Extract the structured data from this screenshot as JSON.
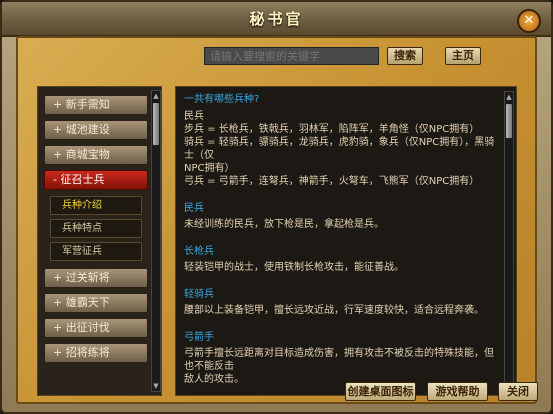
{
  "window": {
    "title": "秘书官",
    "close_label": "✕"
  },
  "search": {
    "placeholder": "请输入要搜索的关键字",
    "search_label": "搜索",
    "home_label": "主页"
  },
  "sidebar": {
    "items": [
      {
        "label": "+ 新手需知"
      },
      {
        "label": "+ 城池建设"
      },
      {
        "label": "+ 商城宝物"
      },
      {
        "label": "- 征召士兵"
      },
      {
        "label": "+ 过关斩将"
      },
      {
        "label": "+ 雄霸天下"
      },
      {
        "label": "+ 出征讨伐"
      },
      {
        "label": "+ 招将练将"
      }
    ],
    "sub_items": [
      {
        "label": "兵种介绍"
      },
      {
        "label": "兵种特点"
      },
      {
        "label": "军营征兵"
      }
    ]
  },
  "content": {
    "q_heading": "一共有哪些兵种?",
    "lines": [
      "民兵",
      "步兵 = 长枪兵，铁戟兵，羽林军，陷阵军，羊角怪（仅NPC拥有）",
      "骑兵 = 轻骑兵，骠骑兵，龙骑兵，虎豹骑，象兵（仅NPC拥有），黑骑士（仅",
      "NPC拥有）",
      "弓兵 = 弓箭手，连弩兵，神箭手，火弩车，飞熊军（仅NPC拥有）"
    ],
    "sections": [
      {
        "heading": "民兵",
        "text": "未经训练的民兵，放下枪是民，拿起枪是兵。"
      },
      {
        "heading": "长枪兵",
        "text": "轻装铠甲的战士，使用铁制长枪攻击，能征善战。"
      },
      {
        "heading": "轻骑兵",
        "text": "腰部以上装备铠甲，擅长远攻近战，行军速度较快，适合远程奔袭。"
      },
      {
        "heading": "弓箭手",
        "text": "弓箭手擅长远距离对目标造成伤害，拥有攻击不被反击的特殊技能，但也不能反击",
        "text2": "敌人的攻击。"
      }
    ]
  },
  "bottom": {
    "create_desktop_icon": "创建桌面图标",
    "game_help": "游戏帮助",
    "close": "关闭"
  },
  "colors": {
    "active_menu": "#a81c12",
    "heading_blue": "#39a8e0",
    "panel_gold": "#c79232"
  }
}
